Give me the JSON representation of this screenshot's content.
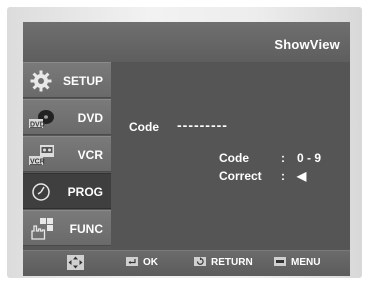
{
  "header": {
    "title": "ShowView"
  },
  "sidebar": {
    "items": [
      {
        "label": "SETUP",
        "icon": "gear-icon",
        "selected": false
      },
      {
        "label": "DVD",
        "icon": "dvd-disc-icon",
        "icon_text": "DVD",
        "selected": false
      },
      {
        "label": "VCR",
        "icon": "vcr-tape-icon",
        "icon_text": "VCR",
        "selected": false
      },
      {
        "label": "PROG",
        "icon": "clock-icon",
        "selected": true
      },
      {
        "label": "FUNC",
        "icon": "hand-function-icon",
        "selected": false
      }
    ]
  },
  "main": {
    "code_label": "Code",
    "code_value": "---------",
    "hints": [
      {
        "key": "Code",
        "sep": ":",
        "value": "0 - 9"
      },
      {
        "key": "Correct",
        "sep": ":",
        "value": "◀"
      }
    ]
  },
  "footer": {
    "move_icon": "move-arrows-icon",
    "ok_label": "OK",
    "return_label": "RETURN",
    "menu_label": "MENU"
  },
  "colors": {
    "screen_bg": "#575757",
    "sidebar_item": "#707070",
    "sidebar_selected": "#3f3f3f",
    "text": "#ffffff"
  }
}
